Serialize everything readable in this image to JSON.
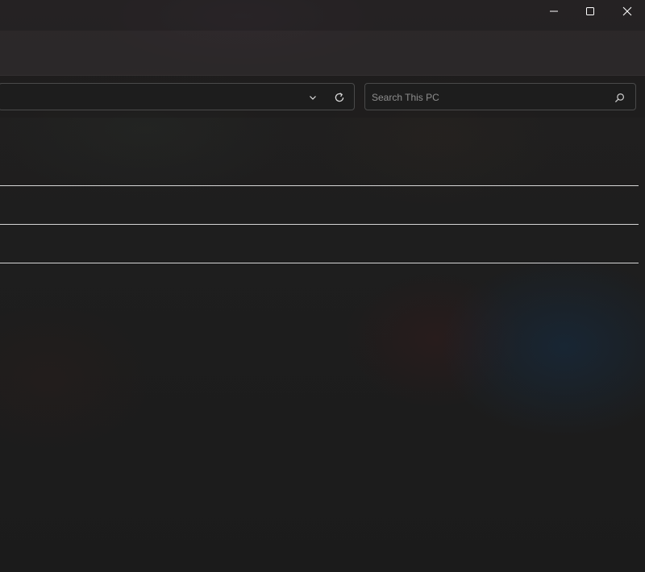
{
  "window": {
    "minimize_icon": "minimize-icon",
    "maximize_icon": "maximize-icon",
    "close_icon": "close-icon"
  },
  "address_bar": {
    "dropdown_icon": "chevron-down-icon",
    "refresh_icon": "refresh-icon"
  },
  "search": {
    "placeholder": "Search This PC",
    "value": "",
    "icon": "search-icon"
  },
  "colors": {
    "divider": "#d6d6d6",
    "field_border": "#4a4a4a",
    "window_bg": "#1c1c1c"
  }
}
